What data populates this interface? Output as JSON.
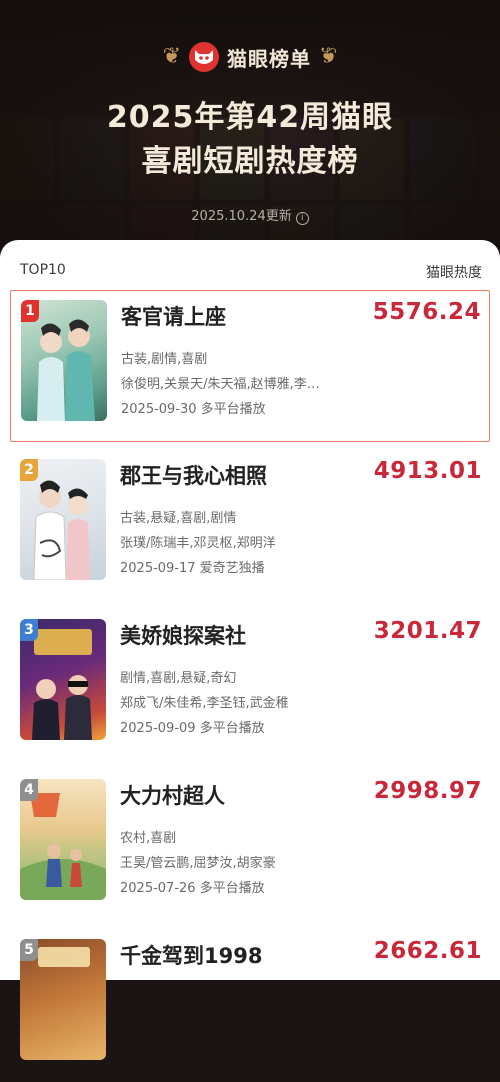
{
  "brand": {
    "name": "猫眼榜单",
    "logo": "cat-face-icon",
    "accent": "#e0322e"
  },
  "title": {
    "line1": "2025年第42周猫眼",
    "line2": "喜剧短剧热度榜"
  },
  "update": {
    "text": "2025.10.24更新",
    "icon": "info-icon"
  },
  "list": {
    "left_header": "TOP10",
    "right_header": "猫眼热度",
    "items": [
      {
        "rank": "1",
        "title": "客官请上座",
        "score": "5576.24",
        "genres": "古装,剧情,喜剧",
        "cast": "徐俊明,关景天/朱天福,赵博雅,李…",
        "release": "2025-09-30 多平台播放"
      },
      {
        "rank": "2",
        "title": "郡王与我心相照",
        "score": "4913.01",
        "genres": "古装,悬疑,喜剧,剧情",
        "cast": "张璞/陈瑞丰,邓灵枢,郑明洋",
        "release": "2025-09-17 爱奇艺独播"
      },
      {
        "rank": "3",
        "title": "美娇娘探案社",
        "score": "3201.47",
        "genres": "剧情,喜剧,悬疑,奇幻",
        "cast": "郑成飞/朱佳希,李圣钰,武金稚",
        "release": "2025-09-09 多平台播放"
      },
      {
        "rank": "4",
        "title": "大力村超人",
        "score": "2998.97",
        "genres": "农村,喜剧",
        "cast": "王昊/管云鹏,屈梦汝,胡家豪",
        "release": "2025-07-26 多平台播放"
      },
      {
        "rank": "5",
        "title": "千金驾到1998",
        "score": "2662.61",
        "genres": "",
        "cast": "",
        "release": ""
      }
    ]
  }
}
